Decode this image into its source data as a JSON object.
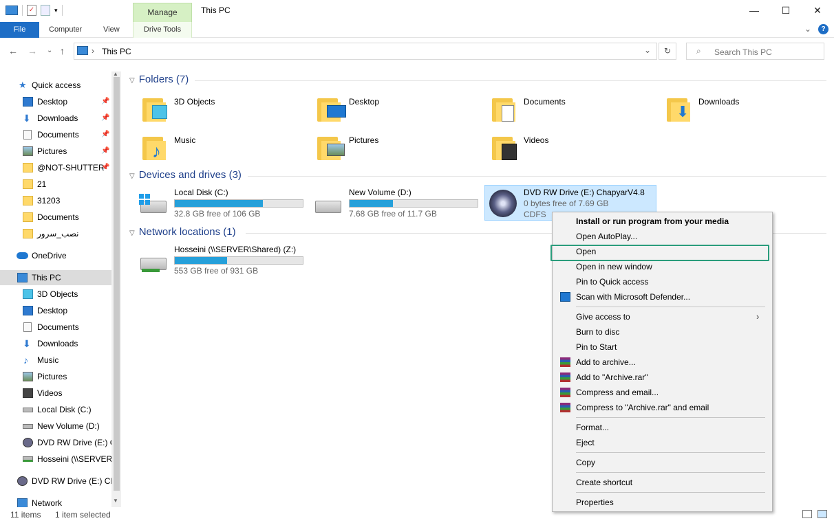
{
  "window": {
    "title": "This PC",
    "manage_tab": "Manage",
    "minimize": "—",
    "maximize": "☐",
    "close": "✕"
  },
  "ribbon": {
    "file": "File",
    "computer": "Computer",
    "view": "View",
    "drive_tools": "Drive Tools",
    "expand": "⌄",
    "help": "?"
  },
  "nav": {
    "back": "←",
    "forward": "→",
    "recent": "⌄",
    "up": "↑",
    "breadcrumb": "This PC",
    "separator": "›",
    "dropdown": "⌄",
    "refresh": "↻",
    "search_placeholder": "Search This PC",
    "search_icon": "⌕"
  },
  "sidebar": {
    "items": [
      {
        "label": "Quick access",
        "icon": "star-icon",
        "pinned": false
      },
      {
        "label": "Desktop",
        "icon": "desktop-icon",
        "pinned": true
      },
      {
        "label": "Downloads",
        "icon": "download-icon",
        "pinned": true
      },
      {
        "label": "Documents",
        "icon": "documents-icon",
        "pinned": true
      },
      {
        "label": "Pictures",
        "icon": "pictures-icon",
        "pinned": true
      },
      {
        "label": "@NOT-SHUTTER-",
        "icon": "folder-icon",
        "pinned": true
      },
      {
        "label": "21",
        "icon": "folder-icon",
        "pinned": false
      },
      {
        "label": "31203",
        "icon": "folder-icon",
        "pinned": false
      },
      {
        "label": "Documents",
        "icon": "folder-icon",
        "pinned": false
      },
      {
        "label": "نصب_سرور",
        "icon": "folder-icon",
        "pinned": false
      },
      {
        "label": "OneDrive",
        "icon": "cloud-icon",
        "pinned": false
      },
      {
        "label": "This PC",
        "icon": "computer-icon",
        "pinned": false
      },
      {
        "label": "3D Objects",
        "icon": "cube-icon",
        "pinned": false
      },
      {
        "label": "Desktop",
        "icon": "desktop-icon",
        "pinned": false
      },
      {
        "label": "Documents",
        "icon": "documents-icon",
        "pinned": false
      },
      {
        "label": "Downloads",
        "icon": "download-icon",
        "pinned": false
      },
      {
        "label": "Music",
        "icon": "music-icon",
        "pinned": false
      },
      {
        "label": "Pictures",
        "icon": "pictures-icon",
        "pinned": false
      },
      {
        "label": "Videos",
        "icon": "videos-icon",
        "pinned": false
      },
      {
        "label": "Local Disk (C:)",
        "icon": "drive-icon",
        "pinned": false
      },
      {
        "label": "New Volume (D:)",
        "icon": "drive-icon",
        "pinned": false
      },
      {
        "label": "DVD RW Drive (E:) Cl",
        "icon": "dvd-icon",
        "pinned": false
      },
      {
        "label": "Hosseini (\\\\SERVER\\",
        "icon": "network-drive-icon",
        "pinned": false
      },
      {
        "label": "DVD RW Drive (E:) Cha",
        "icon": "dvd-icon",
        "pinned": false
      },
      {
        "label": "Network",
        "icon": "network-icon",
        "pinned": false
      }
    ]
  },
  "sections": {
    "folders": "Folders (7)",
    "devices": "Devices and drives (3)",
    "network": "Network locations (1)"
  },
  "folders": [
    {
      "label": "3D Objects",
      "icon": "cube-icon"
    },
    {
      "label": "Desktop",
      "icon": "desktop-icon"
    },
    {
      "label": "Documents",
      "icon": "documents-icon"
    },
    {
      "label": "Downloads",
      "icon": "download-icon"
    },
    {
      "label": "Music",
      "icon": "music-icon"
    },
    {
      "label": "Pictures",
      "icon": "pictures-icon"
    },
    {
      "label": "Videos",
      "icon": "videos-icon"
    }
  ],
  "drives": [
    {
      "name": "Local Disk (C:)",
      "free": "32.8 GB free of 106 GB",
      "used_fraction": 0.69
    },
    {
      "name": "New Volume (D:)",
      "free": "7.68 GB free of 11.7 GB",
      "used_fraction": 0.34
    },
    {
      "name": "DVD RW Drive (E:) ChapyarV4.8",
      "free": "0 bytes free of 7.69 GB",
      "fs": "CDFS"
    }
  ],
  "network_locations": [
    {
      "name": "Hosseini (\\\\SERVER\\Shared) (Z:)",
      "free": "553 GB free of 931 GB",
      "used_fraction": 0.41
    }
  ],
  "context_menu": {
    "items": [
      {
        "label": "Install or run program from your media",
        "bold": true
      },
      {
        "label": "Open AutoPlay..."
      },
      {
        "label": "Open"
      },
      {
        "label": "Open in new window"
      },
      {
        "label": "Pin to Quick access"
      },
      {
        "label": "Scan with Microsoft Defender...",
        "icon": "defender-icon"
      },
      {
        "label": "Give access to",
        "submenu": true
      },
      {
        "label": "Burn to disc"
      },
      {
        "label": "Pin to Start"
      },
      {
        "label": "Add to archive...",
        "icon": "winrar-icon"
      },
      {
        "label": "Add to \"Archive.rar\"",
        "icon": "winrar-icon"
      },
      {
        "label": "Compress and email...",
        "icon": "winrar-icon"
      },
      {
        "label": "Compress to \"Archive.rar\" and email",
        "icon": "winrar-icon"
      },
      {
        "label": "Format..."
      },
      {
        "label": "Eject"
      },
      {
        "label": "Copy"
      },
      {
        "label": "Create shortcut"
      },
      {
        "label": "Properties"
      }
    ],
    "submenu_arrow": "›"
  },
  "status": {
    "items": "11 items",
    "selected": "1 item selected"
  },
  "colors": {
    "accent": "#1e6ec6",
    "bar_fill": "#26a0da",
    "selection": "#cce8ff",
    "highlight_border": "#2a9d7c",
    "manage_tab": "#d6f0c4"
  }
}
